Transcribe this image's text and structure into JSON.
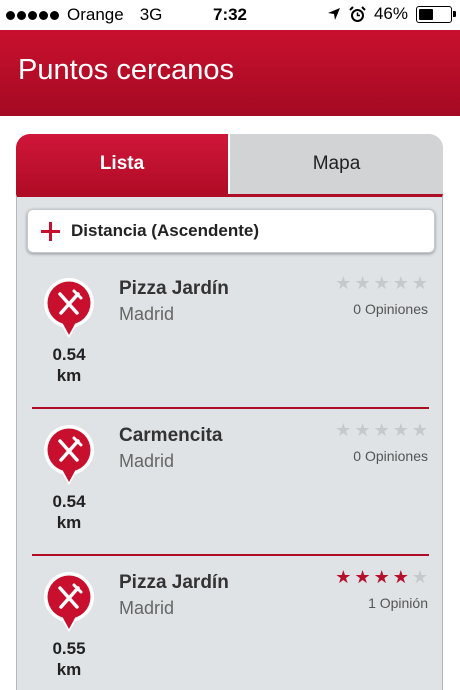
{
  "status_bar": {
    "carrier": "Orange",
    "network": "3G",
    "time": "7:32",
    "battery": "46%",
    "battery_level": 0.46,
    "signal_bars": 5
  },
  "header": {
    "title": "Puntos cercanos"
  },
  "tabs": [
    {
      "label": "Lista",
      "selected": true
    },
    {
      "label": "Mapa",
      "selected": false
    }
  ],
  "sort": {
    "label": "Distancia (Ascendente)"
  },
  "items": [
    {
      "name": "Pizza Jardín",
      "city": "Madrid",
      "distance_value": "0.54",
      "distance_unit": "km",
      "rating": 0,
      "reviews": "0 Opiniones",
      "icon": "restaurant-pin-icon"
    },
    {
      "name": "Carmencita",
      "city": "Madrid",
      "distance_value": "0.54",
      "distance_unit": "km",
      "rating": 0,
      "reviews": "0 Opiniones",
      "icon": "restaurant-pin-icon"
    },
    {
      "name": "Pizza Jardín",
      "city": "Madrid",
      "distance_value": "0.55",
      "distance_unit": "km",
      "rating": 4,
      "reviews": "1 Opinión",
      "icon": "restaurant-pin-icon"
    }
  ],
  "colors": {
    "brand": "#c8102e",
    "star_on": "#b5112d",
    "star_off": "#c6c9cc",
    "list_bg": "#dfe3e6"
  }
}
